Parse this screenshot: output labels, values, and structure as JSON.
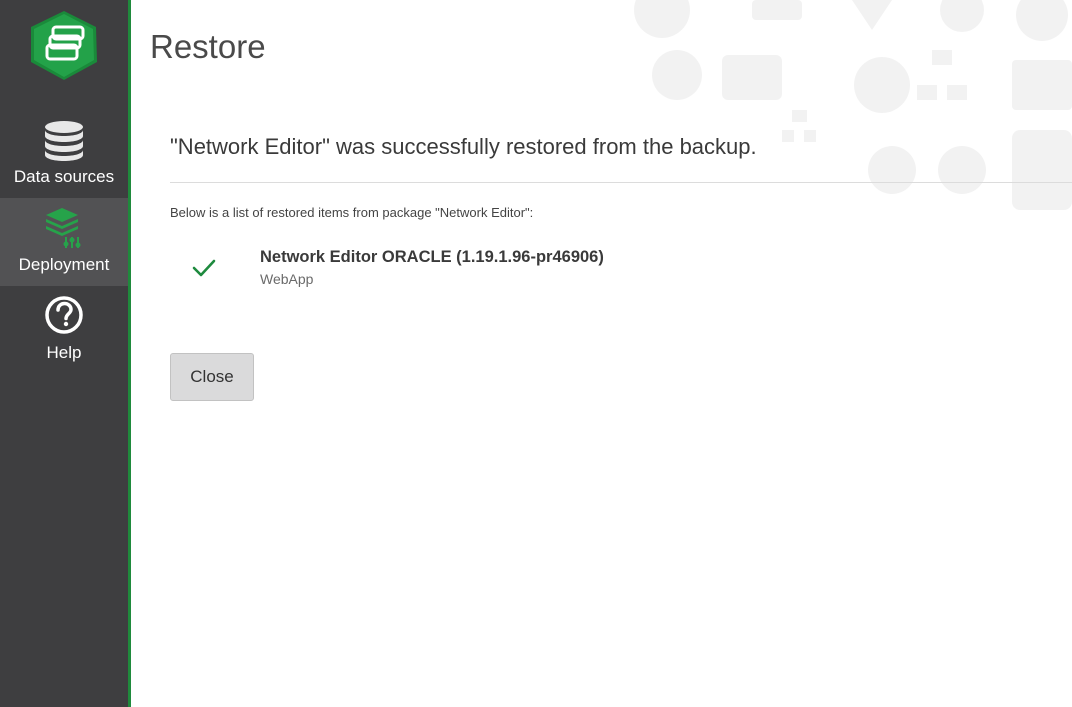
{
  "sidebar": {
    "logo_icon": "stacked-layers-logo",
    "items": [
      {
        "label": "Data sources",
        "icon": "database-icon",
        "active": false
      },
      {
        "label": "Deployment",
        "icon": "deployment-layers-icon",
        "active": true
      },
      {
        "label": "Help",
        "icon": "help-circle-icon",
        "active": false
      }
    ]
  },
  "main": {
    "title": "Restore",
    "message": "\"Network Editor\" was successfully restored from the backup.",
    "list_intro": "Below is a list of restored items from package \"Network Editor\":",
    "items": [
      {
        "status_icon": "check-icon",
        "name": "Network Editor ORACLE (1.19.1.96-pr46906)",
        "type": "WebApp"
      }
    ],
    "close_label": "Close"
  },
  "colors": {
    "sidebar_bg": "#3e3e40",
    "sidebar_active": "#525254",
    "accent_green": "#1f8a3c",
    "check_green": "#1e8a3e"
  }
}
